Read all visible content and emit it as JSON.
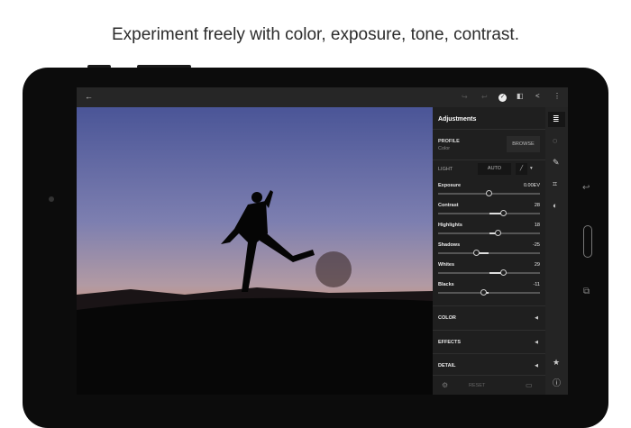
{
  "headline": "Experiment freely with color, exposure, tone, contrast.",
  "panel": {
    "title": "Adjustments",
    "profile_label": "PROFILE",
    "profile_value": "Color",
    "browse": "BROWSE",
    "light_label": "LIGHT",
    "auto": "AUTO",
    "sliders": [
      {
        "label": "Exposure",
        "value": "0.00EV",
        "pos": 0.5
      },
      {
        "label": "Contrast",
        "value": "28",
        "pos": 0.64
      },
      {
        "label": "Highlights",
        "value": "18",
        "pos": 0.59
      },
      {
        "label": "Shadows",
        "value": "-25",
        "pos": 0.38
      },
      {
        "label": "Whites",
        "value": "29",
        "pos": 0.645
      },
      {
        "label": "Blacks",
        "value": "-11",
        "pos": 0.445
      }
    ],
    "sections": [
      "COLOR",
      "EFFECTS",
      "DETAIL"
    ],
    "reset": "RESET"
  },
  "colors": {
    "accent": "#ffffff",
    "panel": "#1f1f1f"
  }
}
